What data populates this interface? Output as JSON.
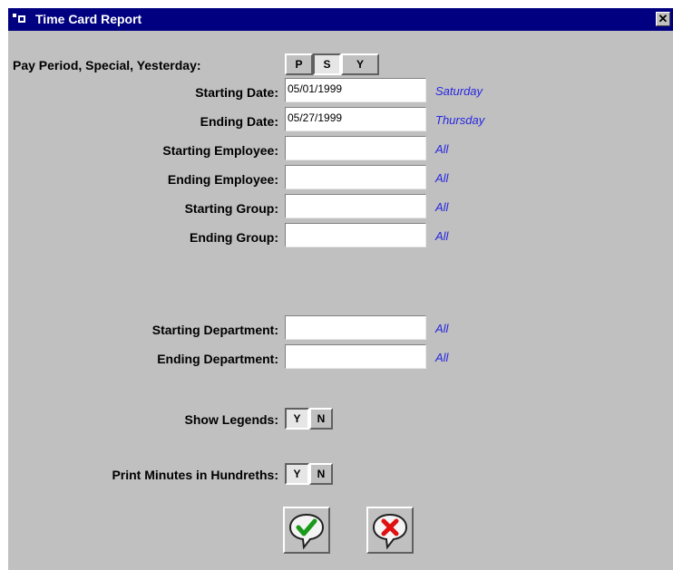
{
  "window": {
    "title": "Time Card Report",
    "close_glyph": "✕"
  },
  "period": {
    "label": "Pay Period, Special, Yesterday:",
    "buttons": [
      {
        "label": "P",
        "pressed": false
      },
      {
        "label": "S",
        "pressed": true
      },
      {
        "label": "Y",
        "pressed": false
      }
    ]
  },
  "fields": {
    "starting_date": {
      "label": "Starting Date:",
      "value": "05/01/1999",
      "hint": "Saturday"
    },
    "ending_date": {
      "label": "Ending Date:",
      "value": "05/27/1999",
      "hint": "Thursday"
    },
    "starting_employee": {
      "label": "Starting Employee:",
      "value": "",
      "hint": "All"
    },
    "ending_employee": {
      "label": "Ending Employee:",
      "value": "",
      "hint": "All"
    },
    "starting_group": {
      "label": "Starting Group:",
      "value": "",
      "hint": "All"
    },
    "ending_group": {
      "label": "Ending Group:",
      "value": "",
      "hint": "All"
    },
    "starting_department": {
      "label": "Starting Department:",
      "value": "",
      "hint": "All"
    },
    "ending_department": {
      "label": "Ending Department:",
      "value": "",
      "hint": "All"
    }
  },
  "show_legends": {
    "label": "Show Legends:",
    "yes": "Y",
    "no": "N",
    "selected": "Y"
  },
  "print_minutes": {
    "label": "Print Minutes in Hundreths:",
    "yes": "Y",
    "no": "N",
    "selected": "Y"
  },
  "actions": {
    "ok_icon": "checkmark-icon",
    "cancel_icon": "x-icon"
  },
  "colors": {
    "titlebar": "#000080",
    "hint": "#2727e0",
    "ok": "#1a9a1a",
    "cancel": "#e01010"
  }
}
